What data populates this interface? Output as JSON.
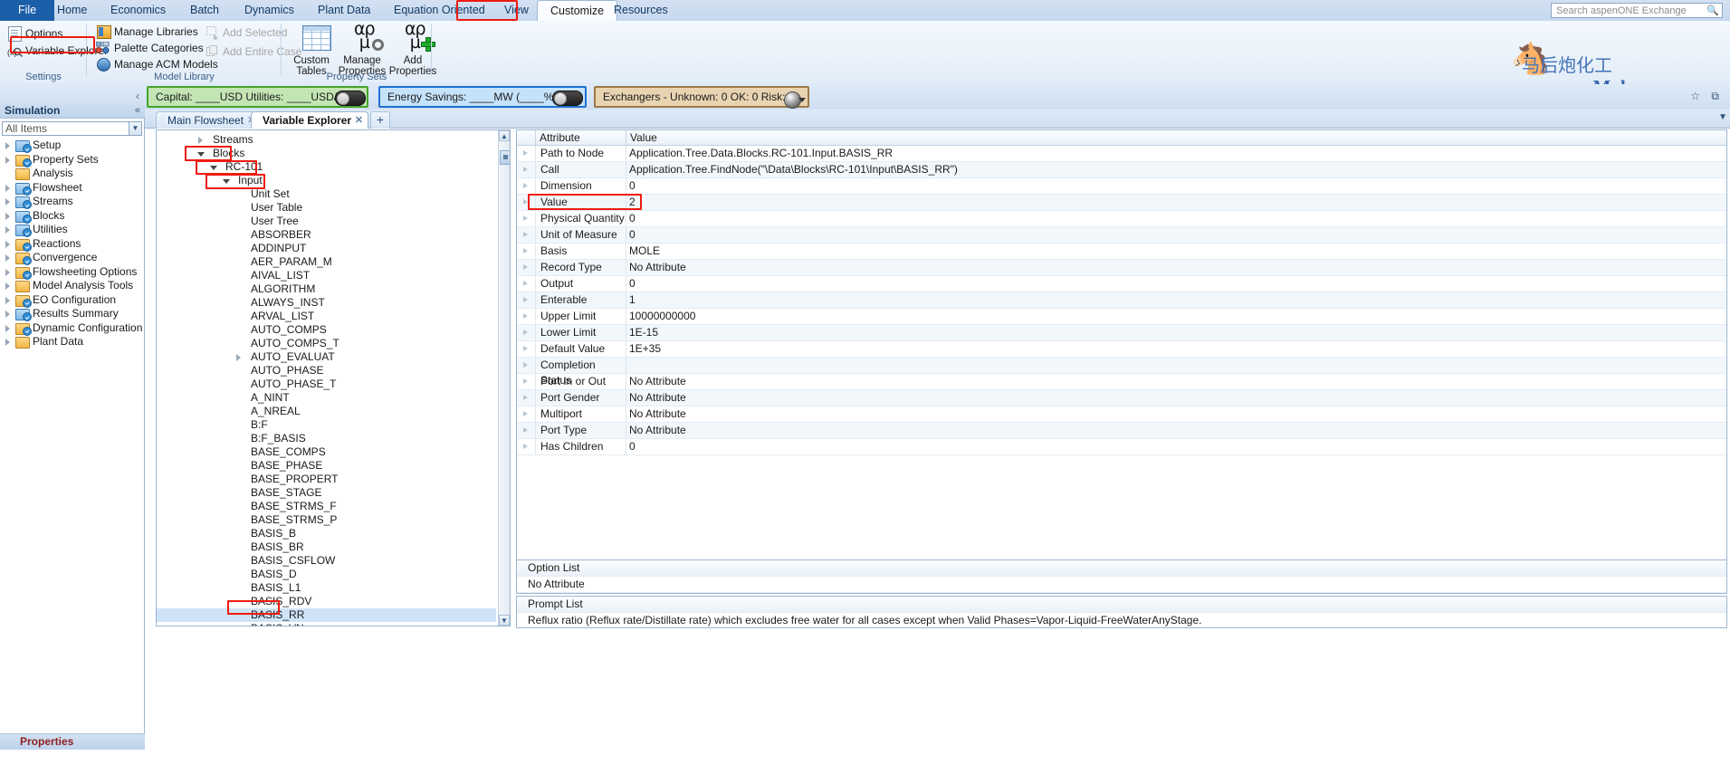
{
  "ribbon": {
    "tabs": [
      {
        "label": "File",
        "kind": "file"
      },
      {
        "label": "Home",
        "kind": "normal"
      },
      {
        "label": "Economics",
        "kind": "normal"
      },
      {
        "label": "Batch",
        "kind": "normal"
      },
      {
        "label": "Dynamics",
        "kind": "normal"
      },
      {
        "label": "Plant Data",
        "kind": "normal"
      },
      {
        "label": "Equation Oriented",
        "kind": "normal"
      },
      {
        "label": "View",
        "kind": "normal"
      },
      {
        "label": "Customize",
        "kind": "active"
      },
      {
        "label": "Resources",
        "kind": "normal"
      }
    ],
    "groups": [
      {
        "name": "Settings",
        "label": "Settings"
      },
      {
        "name": "Model Library",
        "label": "Model Library"
      },
      {
        "name": "Property Sets",
        "label": "Property Sets"
      }
    ],
    "settings": {
      "options_label": "Options",
      "variable_explorer_label": "Variable Explorer"
    },
    "model_library": {
      "manage_libraries_label": "Manage Libraries",
      "palette_categories_label": "Palette Categories",
      "manage_acm_models_label": "Manage ACM Models",
      "add_selected_label": "Add Selected",
      "add_entire_case_label": "Add Entire Case"
    },
    "property_sets": {
      "custom_tables_label": "Custom\nTables",
      "custom_tables_line1": "Custom",
      "custom_tables_line2": "Tables",
      "manage_properties_line1": "Manage",
      "manage_properties_line2": "Properties",
      "add_properties_line1": "Add",
      "add_properties_line2": "Properties"
    },
    "search_placeholder": "Search aspenONE Exchange"
  },
  "watermark": {
    "site": "Mahoupao.com",
    "cn": "马后炮化工"
  },
  "banners": {
    "economics": "Capital: ____USD  Utilities: ____USD/Year",
    "energy": "Energy Savings: ____MW   (____%)",
    "exchangers": "Exchangers -  Unknown: 0   OK: 0   Risk: 0"
  },
  "nav": {
    "header": "Simulation",
    "filter_value": "All Items",
    "items": [
      {
        "label": "Setup",
        "folder": "blue",
        "check": true,
        "expandable": true
      },
      {
        "label": "Property Sets",
        "folder": "yellow",
        "check": true,
        "expandable": true
      },
      {
        "label": "Analysis",
        "folder": "yellow",
        "check": false,
        "expandable": false
      },
      {
        "label": "Flowsheet",
        "folder": "blue",
        "check": true,
        "expandable": true
      },
      {
        "label": "Streams",
        "folder": "blue",
        "check": true,
        "expandable": true
      },
      {
        "label": "Blocks",
        "folder": "blue",
        "check": true,
        "expandable": true
      },
      {
        "label": "Utilities",
        "folder": "blue",
        "check": true,
        "expandable": true
      },
      {
        "label": "Reactions",
        "folder": "yellow",
        "check": true,
        "expandable": true
      },
      {
        "label": "Convergence",
        "folder": "yellow",
        "check": true,
        "expandable": true
      },
      {
        "label": "Flowsheeting Options",
        "folder": "yellow",
        "check": true,
        "expandable": true
      },
      {
        "label": "Model Analysis Tools",
        "folder": "yellow",
        "check": false,
        "expandable": true
      },
      {
        "label": "EO Configuration",
        "folder": "yellow",
        "check": true,
        "expandable": true
      },
      {
        "label": "Results Summary",
        "folder": "blue",
        "check": true,
        "expandable": true
      },
      {
        "label": "Dynamic Configuration",
        "folder": "yellow",
        "check": true,
        "expandable": true
      },
      {
        "label": "Plant Data",
        "folder": "yellow",
        "check": false,
        "expandable": true
      }
    ],
    "bottom_label": "Properties"
  },
  "doctabs": {
    "tabs": [
      {
        "label": "Main Flowsheet",
        "active": false
      },
      {
        "label": "Variable Explorer",
        "active": true
      }
    ],
    "plus": "+"
  },
  "tree": {
    "items": [
      {
        "label": "Streams",
        "indent": 0,
        "twisty": "closed",
        "selected": false
      },
      {
        "label": "Blocks",
        "indent": 0,
        "twisty": "open",
        "selected": false
      },
      {
        "label": "RC-101",
        "indent": 1,
        "twisty": "open",
        "selected": false
      },
      {
        "label": "Input",
        "indent": 2,
        "twisty": "open",
        "selected": false
      },
      {
        "label": "Unit Set",
        "indent": 3,
        "twisty": "none",
        "selected": false
      },
      {
        "label": "User Table",
        "indent": 3,
        "twisty": "none",
        "selected": false
      },
      {
        "label": "User Tree",
        "indent": 3,
        "twisty": "none",
        "selected": false
      },
      {
        "label": "ABSORBER",
        "indent": 3,
        "twisty": "none",
        "selected": false
      },
      {
        "label": "ADDINPUT",
        "indent": 3,
        "twisty": "none",
        "selected": false
      },
      {
        "label": "AER_PARAM_M",
        "indent": 3,
        "twisty": "none",
        "selected": false
      },
      {
        "label": "AIVAL_LIST",
        "indent": 3,
        "twisty": "none",
        "selected": false
      },
      {
        "label": "ALGORITHM",
        "indent": 3,
        "twisty": "none",
        "selected": false
      },
      {
        "label": "ALWAYS_INST",
        "indent": 3,
        "twisty": "none",
        "selected": false
      },
      {
        "label": "ARVAL_LIST",
        "indent": 3,
        "twisty": "none",
        "selected": false
      },
      {
        "label": "AUTO_COMPS",
        "indent": 3,
        "twisty": "none",
        "selected": false
      },
      {
        "label": "AUTO_COMPS_T",
        "indent": 3,
        "twisty": "none",
        "selected": false
      },
      {
        "label": "AUTO_EVALUAT",
        "indent": 3,
        "twisty": "closed",
        "selected": false
      },
      {
        "label": "AUTO_PHASE",
        "indent": 3,
        "twisty": "none",
        "selected": false
      },
      {
        "label": "AUTO_PHASE_T",
        "indent": 3,
        "twisty": "none",
        "selected": false
      },
      {
        "label": "A_NINT",
        "indent": 3,
        "twisty": "none",
        "selected": false
      },
      {
        "label": "A_NREAL",
        "indent": 3,
        "twisty": "none",
        "selected": false
      },
      {
        "label": "B:F",
        "indent": 3,
        "twisty": "none",
        "selected": false
      },
      {
        "label": "B:F_BASIS",
        "indent": 3,
        "twisty": "none",
        "selected": false
      },
      {
        "label": "BASE_COMPS",
        "indent": 3,
        "twisty": "none",
        "selected": false
      },
      {
        "label": "BASE_PHASE",
        "indent": 3,
        "twisty": "none",
        "selected": false
      },
      {
        "label": "BASE_PROPERT",
        "indent": 3,
        "twisty": "none",
        "selected": false
      },
      {
        "label": "BASE_STAGE",
        "indent": 3,
        "twisty": "none",
        "selected": false
      },
      {
        "label": "BASE_STRMS_F",
        "indent": 3,
        "twisty": "none",
        "selected": false
      },
      {
        "label": "BASE_STRMS_P",
        "indent": 3,
        "twisty": "none",
        "selected": false
      },
      {
        "label": "BASIS_B",
        "indent": 3,
        "twisty": "none",
        "selected": false
      },
      {
        "label": "BASIS_BR",
        "indent": 3,
        "twisty": "none",
        "selected": false
      },
      {
        "label": "BASIS_CSFLOW",
        "indent": 3,
        "twisty": "none",
        "selected": false
      },
      {
        "label": "BASIS_D",
        "indent": 3,
        "twisty": "none",
        "selected": false
      },
      {
        "label": "BASIS_L1",
        "indent": 3,
        "twisty": "none",
        "selected": false
      },
      {
        "label": "BASIS_RDV",
        "indent": 3,
        "twisty": "none",
        "selected": false
      },
      {
        "label": "BASIS_RR",
        "indent": 3,
        "twisty": "none",
        "selected": true
      },
      {
        "label": "BASIS_VN",
        "indent": 3,
        "twisty": "none",
        "selected": false
      }
    ]
  },
  "grid": {
    "headers": [
      "Attribute",
      "Value"
    ],
    "rows": [
      {
        "attribute": "Path to Node",
        "value": "Application.Tree.Data.Blocks.RC-101.Input.BASIS_RR"
      },
      {
        "attribute": "Call",
        "value": "Application.Tree.FindNode(\"\\Data\\Blocks\\RC-101\\Input\\BASIS_RR\")"
      },
      {
        "attribute": "Dimension",
        "value": "0"
      },
      {
        "attribute": "Value",
        "value": "2"
      },
      {
        "attribute": "Physical Quantity",
        "value": "0"
      },
      {
        "attribute": "Unit of Measure",
        "value": "0"
      },
      {
        "attribute": "Basis",
        "value": "MOLE"
      },
      {
        "attribute": "Record Type",
        "value": "No Attribute"
      },
      {
        "attribute": "Output",
        "value": "0"
      },
      {
        "attribute": "Enterable",
        "value": "1"
      },
      {
        "attribute": "Upper Limit",
        "value": "10000000000"
      },
      {
        "attribute": "Lower Limit",
        "value": "1E-15"
      },
      {
        "attribute": "Default Value",
        "value": "1E+35"
      },
      {
        "attribute": "Completion Status",
        "value": ""
      },
      {
        "attribute": "Port In or Out",
        "value": "No Attribute"
      },
      {
        "attribute": "Port Gender",
        "value": "No Attribute"
      },
      {
        "attribute": "Multiport",
        "value": "No Attribute"
      },
      {
        "attribute": "Port Type",
        "value": "No Attribute"
      },
      {
        "attribute": "Has Children",
        "value": "0"
      }
    ]
  },
  "option_list": {
    "header": "Option List",
    "value": "No Attribute"
  },
  "prompt_list": {
    "header": "Prompt List",
    "value": "Reflux ratio (Reflux rate/Distillate rate) which excludes free water for all  cases except when Valid Phases=Vapor-Liquid-FreeWaterAnyStage."
  },
  "colors": {
    "highlight": "#ee1b11",
    "file_tab": "#1a5fa8",
    "economics_banner": "#c3e5b4",
    "energy_banner": "#c5e2fb",
    "exchangers_banner": "#e9d4b2",
    "selection": "#cfe3f7"
  }
}
